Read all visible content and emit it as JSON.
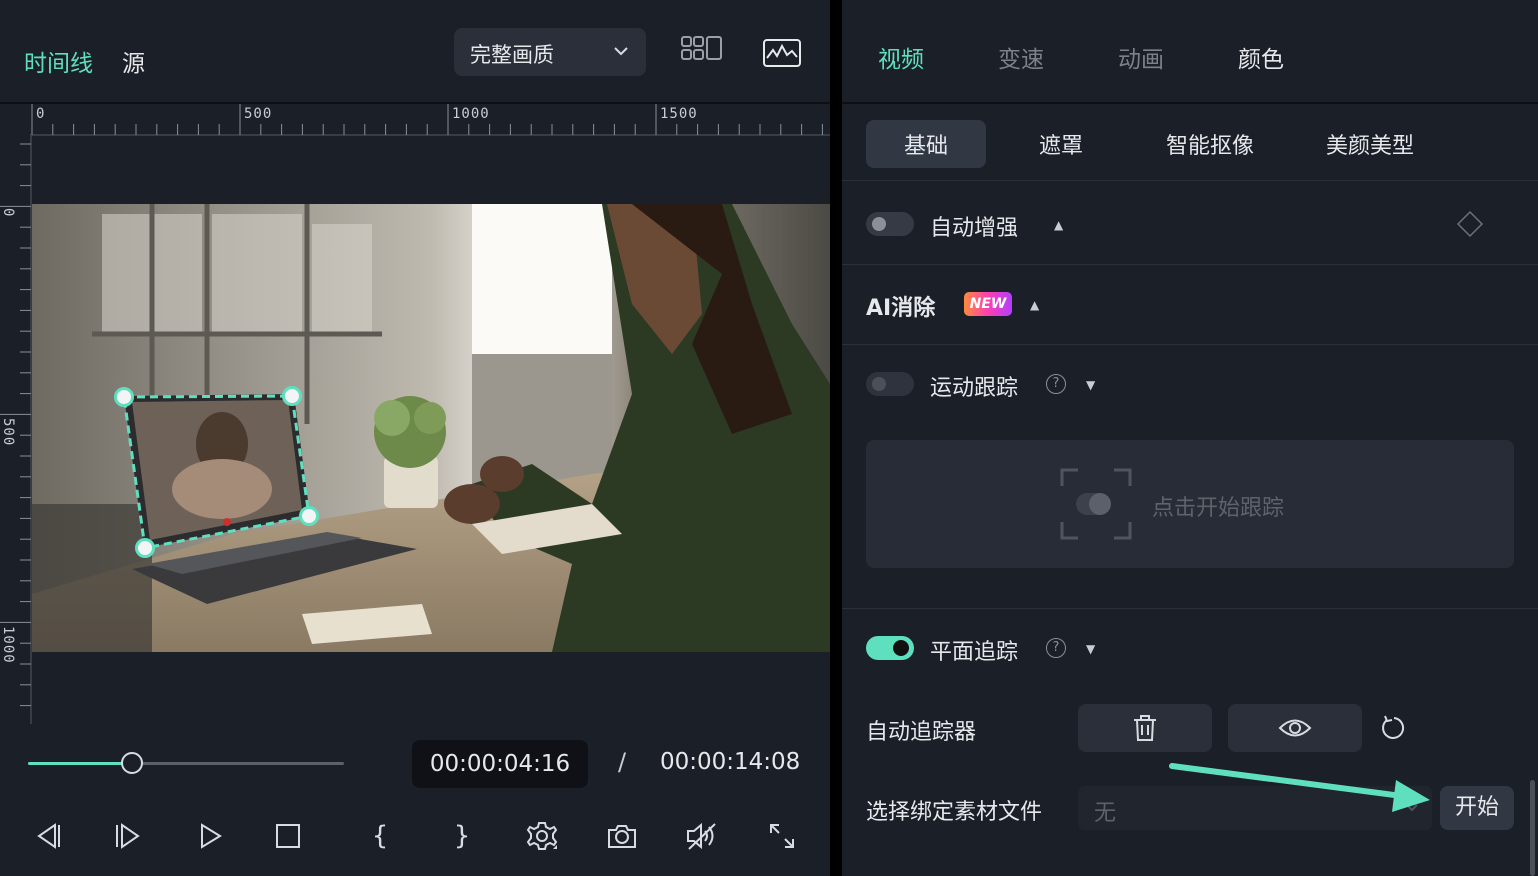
{
  "left_header": {
    "tab_timeline": "时间线",
    "tab_source": "源",
    "quality_select": "完整画质"
  },
  "ruler": {
    "top_marks": [
      "0",
      "500",
      "1000",
      "1500"
    ],
    "left_marks": [
      "0",
      "500",
      "1000"
    ]
  },
  "player": {
    "progress": 0.33,
    "current_time": "00:00:04:16",
    "separator": "/",
    "total_time": "00:00:14:08",
    "open_brace": "{",
    "close_brace": "}"
  },
  "right_tabs": [
    "视频",
    "变速",
    "动画",
    "颜色"
  ],
  "sub_tabs": [
    "基础",
    "遮罩",
    "智能抠像",
    "美颜美型"
  ],
  "rows": {
    "auto_enhance": "自动增强",
    "ai_remove": "AI消除",
    "new_badge": "NEW",
    "motion_tracking": "运动跟踪",
    "click_to_track": "点击开始跟踪",
    "planar_tracking": "平面追踪",
    "auto_tracker": "自动追踪器",
    "select_bind_file": "选择绑定素材文件",
    "select_value": "无",
    "start_button": "开始"
  },
  "colors": {
    "accent": "#5ee0bf",
    "panel_bg": "#1b1f27",
    "badge_gradient": [
      "#ff8a3d",
      "#ff3fb2",
      "#b23dff"
    ]
  }
}
